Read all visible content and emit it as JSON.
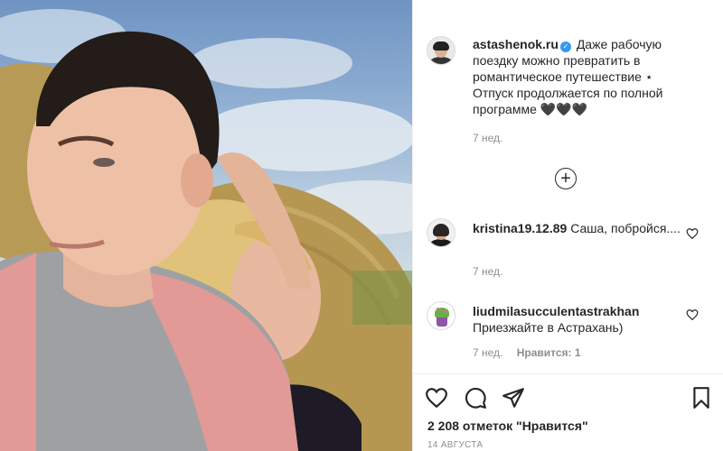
{
  "post": {
    "author": "astashenok.ru",
    "verified_mark": "✓",
    "caption": "Даже рабочую поездку можно превратить в романтическое путешествие ⋆ Отпуск продолжается по полной программе 🖤🖤🖤",
    "age": "7 нед."
  },
  "load_more_icon": "+",
  "comments": [
    {
      "username": "kristina19.12.89",
      "text": "Саша, побройся....",
      "age": "7 нед.",
      "likes": ""
    },
    {
      "username": "liudmilasucculentastrakhan",
      "text": "Приезжайте в Астрахань)",
      "age": "7 нед.",
      "likes": "Нравится: 1"
    }
  ],
  "likes_label": "2 208 отметок \"Нравится\"",
  "date_label": "14 АВГУСТА",
  "icons": {
    "like": "heart-icon",
    "comment": "comment-bubble-icon",
    "share": "paper-plane-icon",
    "save": "bookmark-icon",
    "load_more": "plus-circle-icon",
    "comment_like": "small-heart-icon"
  },
  "colors": {
    "text": "#262626",
    "muted": "#8e8e8e",
    "verified": "#3897f0",
    "border": "#efefef"
  }
}
